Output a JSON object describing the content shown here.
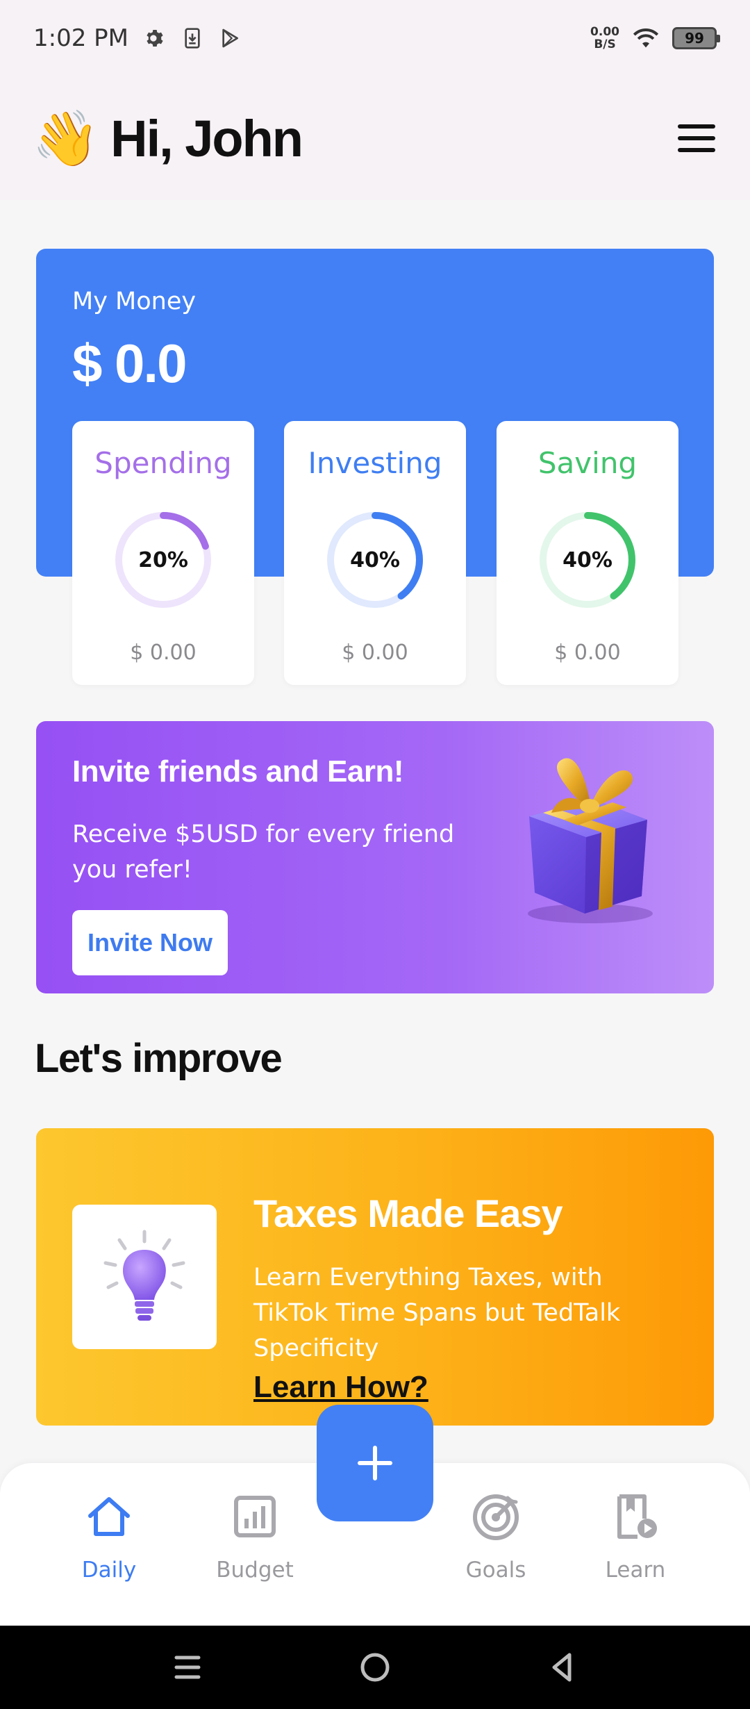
{
  "status_bar": {
    "time": "1:02 PM",
    "net_speed_value": "0.00",
    "net_speed_unit": "B/S",
    "battery": "99",
    "icons": [
      "gear-icon",
      "download-icon",
      "play-store-icon",
      "wifi-icon",
      "battery-icon"
    ]
  },
  "header": {
    "wave_emoji": "👋",
    "greeting": "Hi, John"
  },
  "money": {
    "label": "My Money",
    "value": "$ 0.0",
    "accent": "#4380f5"
  },
  "categories": [
    {
      "title": "Spending",
      "percent_label": "20%",
      "percent": 0.2,
      "amount": "$ 0.00",
      "color": "#a46fe8",
      "track": "#eee4fc"
    },
    {
      "title": "Investing",
      "percent_label": "40%",
      "percent": 0.4,
      "amount": "$ 0.00",
      "color": "#3f7ef2",
      "track": "#e0e9fd"
    },
    {
      "title": "Saving",
      "percent_label": "40%",
      "percent": 0.4,
      "amount": "$ 0.00",
      "color": "#41c36b",
      "track": "#e3f7ea"
    }
  ],
  "invite": {
    "title": "Invite friends and Earn!",
    "subtitle": "Receive $5USD for every friend you refer!",
    "button": "Invite Now"
  },
  "improve": {
    "heading": "Let's improve"
  },
  "taxes": {
    "title": "Taxes Made Easy",
    "description": "Learn Everything Taxes, with TikTok Time Spans but TedTalk Specificity",
    "link": "Learn How?"
  },
  "bottom_nav": {
    "items": [
      {
        "label": "Daily",
        "icon": "home-icon",
        "active": true
      },
      {
        "label": "Budget",
        "icon": "bar-chart-icon",
        "active": false
      },
      {
        "label": "Goals",
        "icon": "target-icon",
        "active": false
      },
      {
        "label": "Learn",
        "icon": "lesson-icon",
        "active": false
      }
    ],
    "fab_icon": "plus-icon"
  }
}
